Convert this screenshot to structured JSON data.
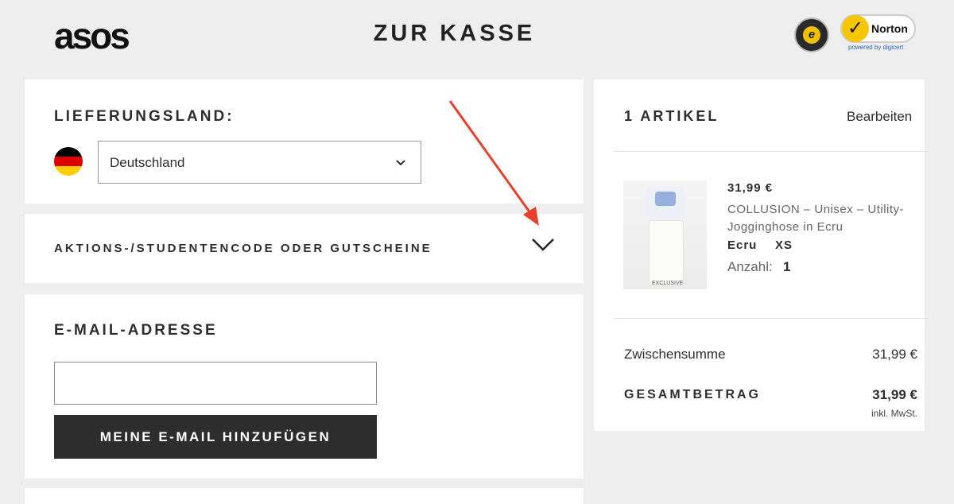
{
  "header": {
    "logo_text": "asos",
    "page_title": "ZUR KASSE",
    "trust_badge": "e",
    "norton_label": "Norton",
    "norton_sub": "powered by digicert"
  },
  "shipping": {
    "heading": "LIEFERUNGSLAND:",
    "country": "Deutschland",
    "flag_icon": "flag-de-icon"
  },
  "promo": {
    "label": "AKTIONS-/STUDENTENCODE ODER GUTSCHEINE"
  },
  "email": {
    "heading": "E-MAIL-ADRESSE",
    "value": "",
    "placeholder": "",
    "button_label": "MEINE E-MAIL HINZUFÜGEN"
  },
  "summary": {
    "items_count": "1 ARTIKEL",
    "edit_label": "Bearbeiten",
    "product": {
      "price": "31,99 €",
      "name": "COLLUSION – Unisex – Utility-Jogginghose in Ecru",
      "color": "Ecru",
      "size": "XS",
      "quantity_label": "Anzahl:",
      "quantity": "1",
      "badge": "EXCLUSIVE"
    },
    "subtotal_label": "Zwischensumme",
    "subtotal_value": "31,99 €",
    "total_label": "GESAMTBETRAG",
    "total_value": "31,99 €",
    "tax_note": "inkl. MwSt."
  },
  "colors": {
    "background": "#eeeeee",
    "button": "#2d2d2d",
    "annotation_arrow": "#e8402a"
  }
}
